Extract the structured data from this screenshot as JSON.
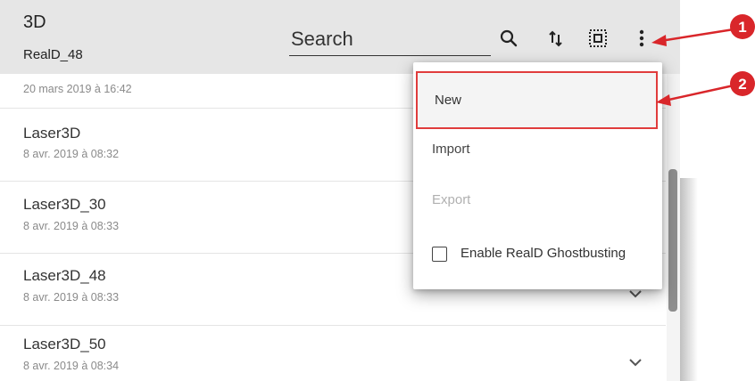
{
  "header": {
    "title": "3D",
    "subtitle": "RealD_48",
    "search_placeholder": "Search",
    "icons": [
      "search-icon",
      "sort-icon",
      "select-all-icon",
      "more-vert-icon"
    ]
  },
  "list": {
    "partial_row_date": "20 mars 2019 à 16:42",
    "items": [
      {
        "name": "Laser3D",
        "date": "8 avr. 2019 à 08:32"
      },
      {
        "name": "Laser3D_30",
        "date": "8 avr. 2019 à 08:33"
      },
      {
        "name": "Laser3D_48",
        "date": "8 avr. 2019 à 08:33"
      },
      {
        "name": "Laser3D_50",
        "date": "8 avr. 2019 à 08:34"
      }
    ]
  },
  "menu": {
    "new": "New",
    "import": "Import",
    "export": "Export",
    "ghostbusting": "Enable RealD Ghostbusting",
    "ghostbusting_checked": false
  },
  "callouts": [
    {
      "number": "1"
    },
    {
      "number": "2"
    }
  ],
  "colors": {
    "header_bg": "#e6e6e6",
    "callout_red": "#d9262a",
    "highlight_border": "#e03c3c"
  }
}
